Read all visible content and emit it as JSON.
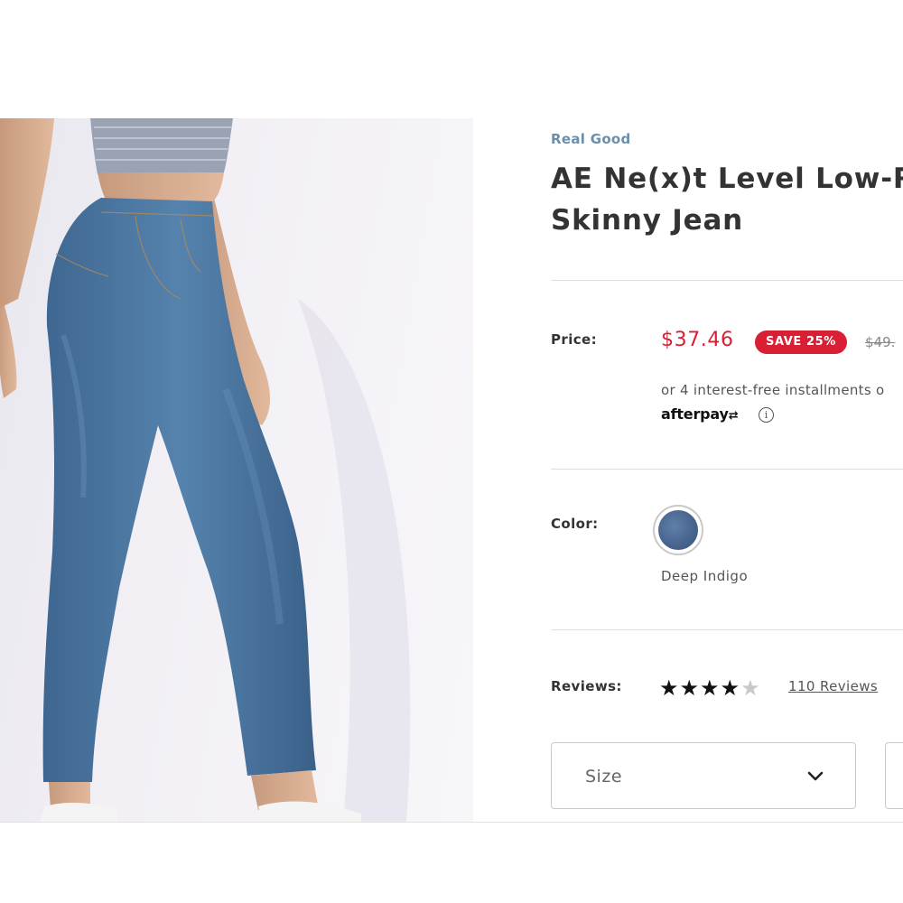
{
  "product": {
    "brand": "Real Good",
    "title_line1": "AE Ne(x)t Level Low-R",
    "title_line2": "Skinny Jean"
  },
  "price": {
    "label": "Price:",
    "sale": "$37.46",
    "badge": "SAVE 25%",
    "original": "$49.",
    "installments": "or 4 interest-free installments o",
    "afterpay_logo": "afterpay",
    "info_icon": "info-icon"
  },
  "color": {
    "label": "Color:",
    "selected_name": "Deep Indigo",
    "swatch_hex": "#4a6790"
  },
  "reviews": {
    "label": "Reviews:",
    "rating": 4,
    "max": 5,
    "link_text": "110 Reviews"
  },
  "size_select": {
    "placeholder": "Size",
    "icon": "chevron-down-icon"
  },
  "colors": {
    "accent_red": "#d81f33",
    "brand_blue": "#6b8fa8"
  }
}
